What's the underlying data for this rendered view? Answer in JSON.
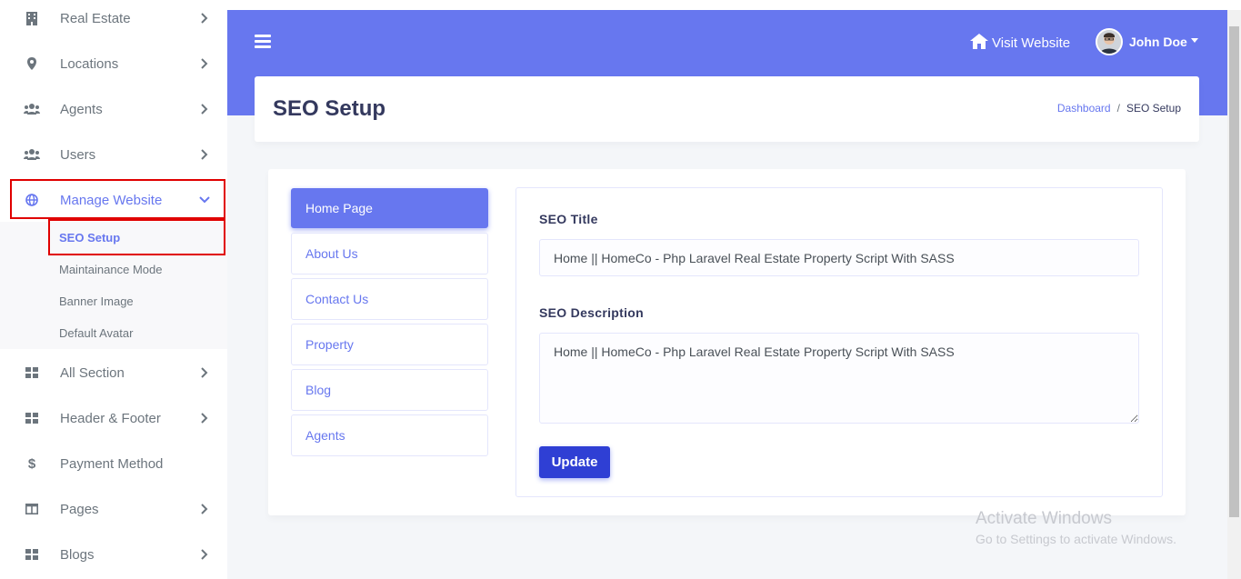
{
  "sidebar": {
    "items": [
      {
        "label": "Real Estate",
        "icon": "building-icon"
      },
      {
        "label": "Locations",
        "icon": "map-marker-icon"
      },
      {
        "label": "Agents",
        "icon": "users-icon"
      },
      {
        "label": "Users",
        "icon": "users-icon"
      },
      {
        "label": "Manage Website",
        "icon": "globe-icon"
      },
      {
        "label": "All Section",
        "icon": "grid-icon"
      },
      {
        "label": "Header & Footer",
        "icon": "grid-icon"
      },
      {
        "label": "Payment Method",
        "icon": "dollar-icon"
      },
      {
        "label": "Pages",
        "icon": "columns-icon"
      },
      {
        "label": "Blogs",
        "icon": "grid-icon"
      }
    ],
    "submenu": [
      "SEO Setup",
      "Maintainance Mode",
      "Banner Image",
      "Default Avatar"
    ]
  },
  "topbar": {
    "visit_label": "Visit Website",
    "user_name": "John Doe"
  },
  "header": {
    "title": "SEO Setup",
    "breadcrumb_home": "Dashboard",
    "breadcrumb_sep": "/",
    "breadcrumb_current": "SEO Setup"
  },
  "tabs": [
    "Home Page",
    "About Us",
    "Contact Us",
    "Property",
    "Blog",
    "Agents"
  ],
  "form": {
    "seo_title_label": "SEO Title",
    "seo_title_value": "Home || HomeCo - Php Laravel Real Estate Property Script With SASS",
    "seo_description_label": "SEO Description",
    "seo_description_value": "Home || HomeCo - Php Laravel Real Estate Property Script With SASS",
    "update_label": "Update"
  },
  "watermark": {
    "line1": "Activate Windows",
    "line2": "Go to Settings to activate Windows."
  },
  "colors": {
    "primary": "#6777ef",
    "highlight": "#e00000",
    "button": "#2f3fd4"
  }
}
